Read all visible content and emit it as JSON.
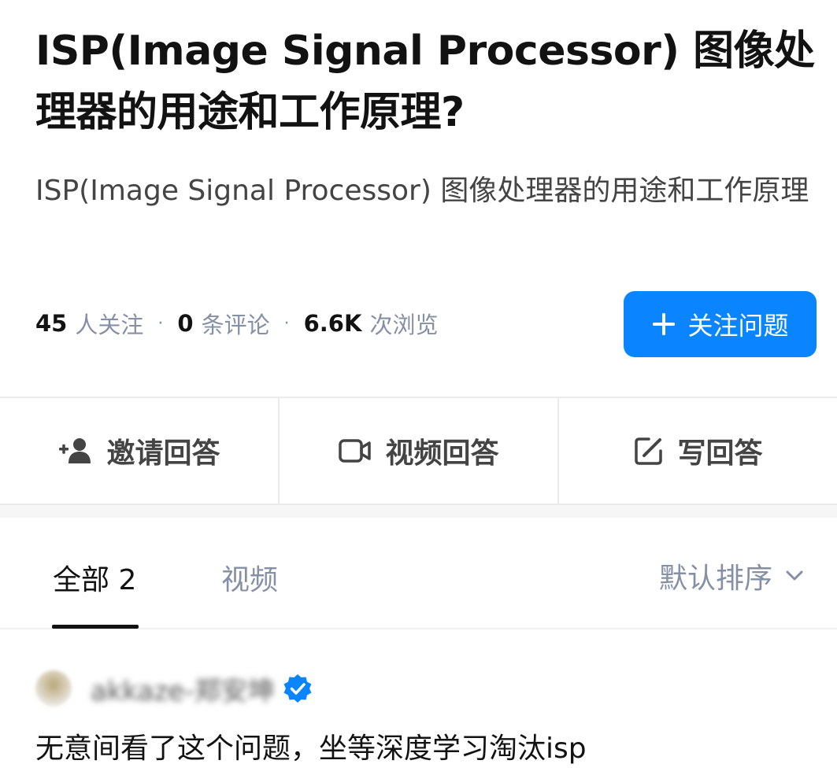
{
  "question": {
    "title": "ISP(Image Signal Processor) 图像处理器的用途和工作原理?",
    "description": "ISP(Image Signal Processor) 图像处理器的用途和工作原理"
  },
  "stats": {
    "followers_count": "45",
    "followers_unit": "人关注",
    "comments_count": "0",
    "comments_unit": "条评论",
    "views_count": "6.6K",
    "views_unit": "次浏览",
    "separator": "·"
  },
  "follow_button": {
    "label": "关注问题",
    "icon": "plus-icon",
    "color": "#0a84ff"
  },
  "actions": [
    {
      "label": "邀请回答",
      "icon": "add-person-icon"
    },
    {
      "label": "视频回答",
      "icon": "video-camera-icon"
    },
    {
      "label": "写回答",
      "icon": "edit-icon"
    }
  ],
  "tabs": {
    "all_label": "全部 2",
    "video_label": "视频"
  },
  "sort": {
    "label": "默认排序",
    "icon": "chevron-down-icon"
  },
  "answer": {
    "author_name": "akkaze-郑安坤",
    "verified_icon": "verified-badge-icon",
    "excerpt": "无意间看了这个问题，坐等深度学习淘汰isp"
  }
}
